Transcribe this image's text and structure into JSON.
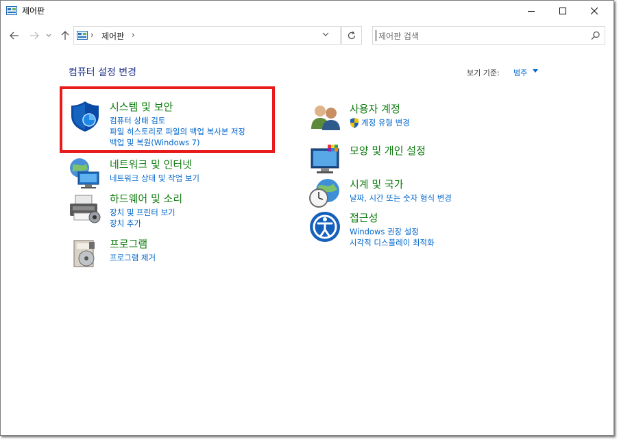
{
  "window": {
    "title": "제어판"
  },
  "address": {
    "location": "제어판",
    "separator": "›"
  },
  "search": {
    "placeholder": "제어판 검색"
  },
  "content": {
    "heading": "컴퓨터 설정 변경",
    "view_by_label": "보기 기준:",
    "view_by_value": "범주"
  },
  "categories": [
    {
      "title": "시스템 및 보안",
      "links": [
        "컴퓨터 상태 검토",
        "파일 히스토리로 파일의 백업 복사본 저장",
        "백업 및 복원(Windows 7)"
      ],
      "icon": "shield-icon"
    },
    {
      "title": "네트워크 및 인터넷",
      "links": [
        "네트워크 상태 및 작업 보기"
      ],
      "icon": "network-icon"
    },
    {
      "title": "하드웨어 및 소리",
      "links": [
        "장치 및 프린터 보기",
        "장치 추가"
      ],
      "icon": "printer-icon"
    },
    {
      "title": "프로그램",
      "links": [
        "프로그램 제거"
      ],
      "icon": "programs-icon"
    },
    {
      "title": "사용자 계정",
      "links": [
        "계정 유형 변경"
      ],
      "icon": "users-icon"
    },
    {
      "title": "모양 및 개인 설정",
      "links": [],
      "icon": "display-icon"
    },
    {
      "title": "시계 및 국가",
      "links": [
        "날짜, 시간 또는 숫자 형식 변경"
      ],
      "icon": "clock-globe-icon"
    },
    {
      "title": "접근성",
      "links": [
        "Windows 권장 설정",
        "시각적 디스플레이 최적화"
      ],
      "icon": "accessibility-icon"
    }
  ],
  "colors": {
    "heading": "#1e3287",
    "category_title": "#107c10",
    "link": "#0066cc",
    "highlight": "#e81a1a"
  }
}
